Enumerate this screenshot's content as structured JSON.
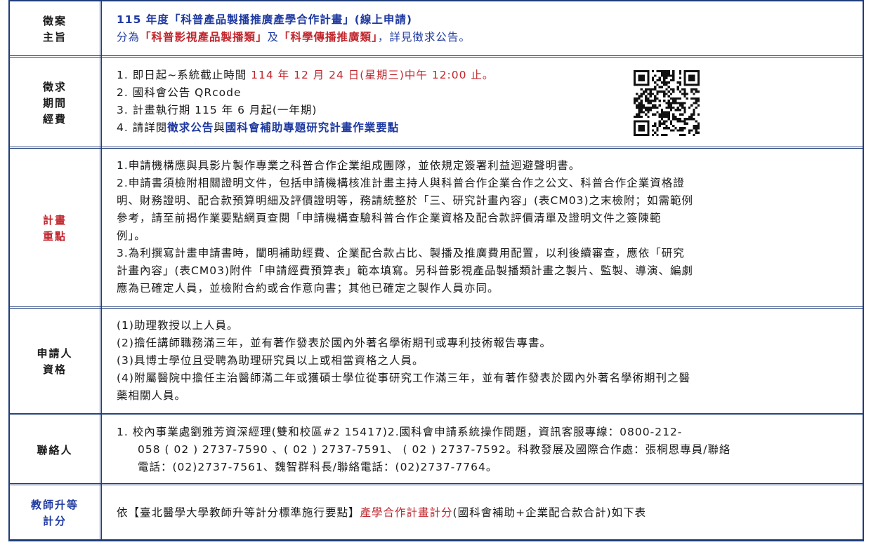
{
  "rows": {
    "purpose": {
      "label_lines": [
        "徵案",
        "主旨"
      ],
      "line1": "115 年度「科普產品製播推廣產學合作計畫」(線上申請)",
      "line2_prefix": "分為",
      "category1": "「科普影視產品製播類」",
      "line2_mid": "及",
      "category2": "「科學傳播推廣類」",
      "line2_suffix": "，詳見徵求公告。"
    },
    "period": {
      "label_lines": [
        "徵求",
        "期間",
        "經費"
      ],
      "item1_prefix": "1.  即日起~系統截止時間 ",
      "item1_deadline": "114 年 12 月 24 日(星期三)中午 12:00 止。",
      "item2": "2.  國科會公告 QRcode",
      "item3": "3.  計畫執行期 115 年 6 月起(一年期)",
      "item4_prefix": "4.  請詳閱",
      "item4_link1": "徵求公告",
      "item4_mid": "與",
      "item4_link2": "國科會補助專題研究計畫作業要點",
      "qr_icon": "qr-code-icon"
    },
    "key_points": {
      "label_lines": [
        "計畫",
        "重點"
      ],
      "lines": [
        "1.申請機構應與具影片製作專業之科普合作企業組成團隊，並依規定簽署利益迴避聲明書。",
        "2.申請書須檢附相關證明文件，包括申請機構核准計畫主持人與科普合作企業合作之公文、科普合作企業資格證",
        "明、財務證明、配合款預算明細及評價證明等，務請統整於「三、研究計畫內容」(表CM03)之末檢附；如需範例",
        "參考，請至前揭作業要點網頁查閱「申請機構查驗科普合作企業資格及配合款評價清單及證明文件之簽陳範",
        "例」。",
        "3.為利撰寫計畫申請書時，闡明補助經費、企業配合款占比、製播及推廣費用配置，以利後續審查，應依「研究",
        "計畫內容」(表CM03)附件「申請經費預算表」範本填寫。另科普影視產品製播類計畫之製片、監製、導演、編劇",
        "應為已確定人員，並檢附合約或合作意向書；其他已確定之製作人員亦同。"
      ]
    },
    "eligibility": {
      "label_lines": [
        "申請人",
        "資格"
      ],
      "lines": [
        "(1)助理教授以上人員。",
        "(2)擔任講師職務滿三年，並有著作發表於國內外著名學術期刊或專利技術報告專書。",
        "(3)具博士學位且受聘為助理研究員以上或相當資格之人員。",
        "(4)附屬醫院中擔任主治醫師滿二年或獲碩士學位從事研究工作滿三年，並有著作發表於國內外著名學術期刊之醫",
        "藥相關人員。"
      ]
    },
    "contact": {
      "label_lines": [
        "聯絡人"
      ],
      "lines": [
        "1.  校內事業處劉雅芳資深經理(雙和校區#2 15417)2.國科會申請系統操作問題，資訊客服專線：0800-212-",
        "058 ( 02 ) 2737-7590 、( 02 ) 2737-7591、 ( 02 ) 2737-7592。科教發展及國際合作處：張桐恩專員/聯絡",
        "電話：(02)2737-7561、魏智群科長/聯絡電話：(02)2737-7764。"
      ]
    },
    "promotion": {
      "label_lines": [
        "教師升等",
        "計分"
      ],
      "prefix": "依【臺北醫學大學教師升等計分標準施行要點】",
      "highlight": "產學合作計畫計分",
      "suffix": "(國科會補助+企業配合款合計)如下表"
    }
  },
  "colors": {
    "border": "#1f3c78",
    "navy_text": "#1f3aa0",
    "red_text": "#c0262d"
  }
}
